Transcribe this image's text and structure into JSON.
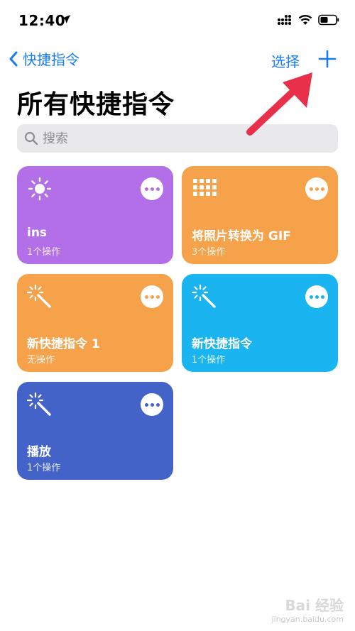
{
  "status_bar": {
    "time": "12:40"
  },
  "nav": {
    "back_label": "快捷指令",
    "select_label": "选择"
  },
  "page": {
    "title": "所有快捷指令"
  },
  "search": {
    "placeholder": "搜索"
  },
  "shortcuts": [
    {
      "title": "ins",
      "subtitle": "1个操作",
      "color": "#b36fe8",
      "icon": "sun-icon"
    },
    {
      "title": "将照片转换为 GIF",
      "subtitle": "3个操作",
      "color": "#f5a24b",
      "icon": "grid-icon"
    },
    {
      "title": "新快捷指令 1",
      "subtitle": "无操作",
      "color": "#f5a24b",
      "icon": "magic-wand-icon"
    },
    {
      "title": "新快捷指令",
      "subtitle": "1个操作",
      "color": "#1ab4f0",
      "icon": "magic-wand-icon"
    },
    {
      "title": "播放",
      "subtitle": "1个操作",
      "color": "#4463c9",
      "icon": "magic-wand-icon"
    }
  ],
  "annotation": {
    "arrow_color": "#e8304a"
  },
  "watermark": {
    "brand": "Bai 经验",
    "url": "jingyan.baidu.com"
  }
}
